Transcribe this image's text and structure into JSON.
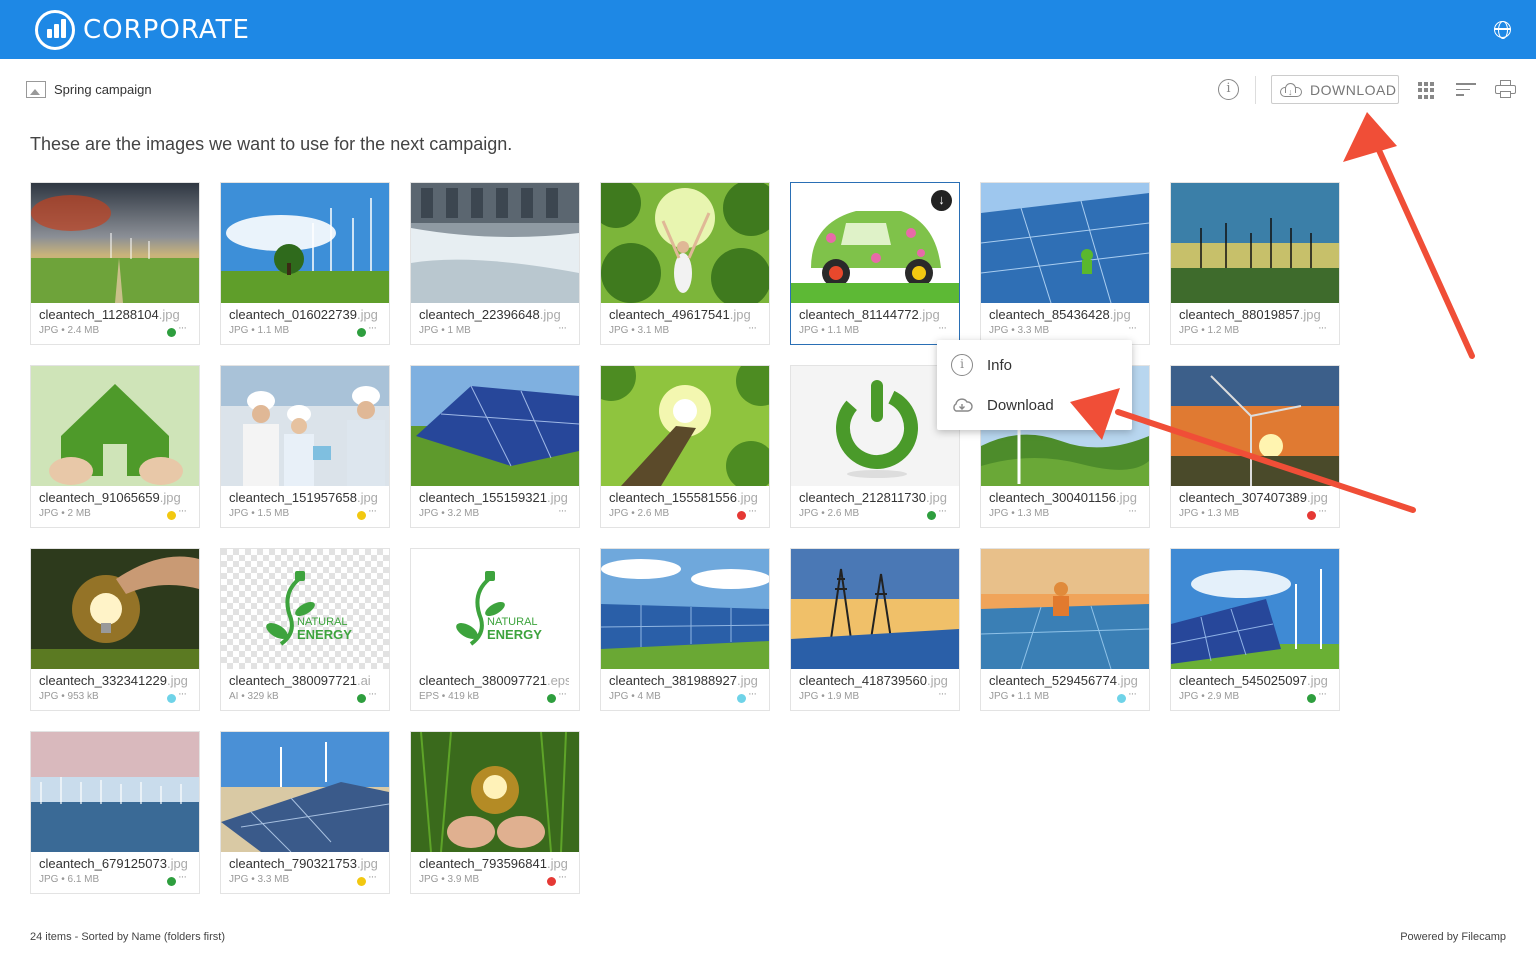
{
  "header": {
    "brand": "CORPORATE",
    "logo_icon": "bar-chart-logo-icon",
    "language_icon": "globe-icon",
    "color": "#1e88e5"
  },
  "toolbar": {
    "breadcrumb": "Spring campaign",
    "breadcrumb_icon": "image-folder-icon",
    "info_icon": "info-icon",
    "download_label": "DOWNLOAD",
    "view_icon": "grid-view-icon",
    "sort_icon": "sort-icon",
    "print_icon": "print-icon"
  },
  "description": "These are the images we want to use for the next campaign.",
  "items": [
    {
      "name": "cleantech_11288104",
      "ext": ".jpg",
      "meta": "JPG • 2.4 MB",
      "status": "#2e9e3e"
    },
    {
      "name": "cleantech_016022739",
      "ext": ".jpg",
      "meta": "JPG • 1.1 MB",
      "status": "#2e9e3e"
    },
    {
      "name": "cleantech_22396648",
      "ext": ".jpg",
      "meta": "JPG • 1 MB",
      "status": ""
    },
    {
      "name": "cleantech_49617541",
      "ext": ".jpg",
      "meta": "JPG • 3.1 MB",
      "status": ""
    },
    {
      "name": "cleantech_81144772",
      "ext": ".jpg",
      "meta": "JPG • 1.1 MB",
      "status": ""
    },
    {
      "name": "cleantech_85436428",
      "ext": ".jpg",
      "meta": "JPG • 3.3 MB",
      "status": ""
    },
    {
      "name": "cleantech_88019857",
      "ext": ".jpg",
      "meta": "JPG • 1.2 MB",
      "status": ""
    },
    {
      "name": "cleantech_91065659",
      "ext": ".jpg",
      "meta": "JPG • 2 MB",
      "status": "#f2c811"
    },
    {
      "name": "cleantech_151957658",
      "ext": ".jpg",
      "meta": "JPG • 1.5 MB",
      "status": "#f2c811"
    },
    {
      "name": "cleantech_155159321",
      "ext": ".jpg",
      "meta": "JPG • 3.2 MB",
      "status": ""
    },
    {
      "name": "cleantech_155581556",
      "ext": ".jpg",
      "meta": "JPG • 2.6 MB",
      "status": "#e53935"
    },
    {
      "name": "cleantech_212811730",
      "ext": ".jpg",
      "meta": "JPG • 2.6 MB",
      "status": "#2e9e3e"
    },
    {
      "name": "cleantech_300401156",
      "ext": ".jpg",
      "meta": "JPG • 1.3 MB",
      "status": ""
    },
    {
      "name": "cleantech_307407389",
      "ext": ".jpg",
      "meta": "JPG • 1.3 MB",
      "status": "#e53935"
    },
    {
      "name": "cleantech_332341229",
      "ext": ".jpg",
      "meta": "JPG • 953 kB",
      "status": "#6fd3e8"
    },
    {
      "name": "cleantech_380097721",
      "ext": ".ai",
      "meta": "AI • 329 kB",
      "status": "#2e9e3e"
    },
    {
      "name": "cleantech_380097721",
      "ext": ".eps",
      "meta": "EPS • 419 kB",
      "status": "#2e9e3e"
    },
    {
      "name": "cleantech_381988927",
      "ext": ".jpg",
      "meta": "JPG • 4 MB",
      "status": "#6fd3e8"
    },
    {
      "name": "cleantech_418739560",
      "ext": ".jpg",
      "meta": "JPG • 1.9 MB",
      "status": ""
    },
    {
      "name": "cleantech_529456774",
      "ext": ".jpg",
      "meta": "JPG • 1.1 MB",
      "status": "#6fd3e8"
    },
    {
      "name": "cleantech_545025097",
      "ext": ".jpg",
      "meta": "JPG • 2.9 MB",
      "status": "#2e9e3e"
    },
    {
      "name": "cleantech_679125073",
      "ext": ".jpg",
      "meta": "JPG • 6.1 MB",
      "status": "#2e9e3e"
    },
    {
      "name": "cleantech_790321753",
      "ext": ".jpg",
      "meta": "JPG • 3.3 MB",
      "status": "#f2c811"
    },
    {
      "name": "cleantech_793596841",
      "ext": ".jpg",
      "meta": "JPG • 3.9 MB",
      "status": "#e53935"
    }
  ],
  "more_label": "···",
  "context_menu": {
    "info_label": "Info",
    "download_label": "Download"
  },
  "footer": {
    "summary": "24 items - Sorted by Name (folders first)",
    "powered": "Powered by Filecamp"
  },
  "thumb_logo": {
    "line1": "NATURAL",
    "line2": "ENERGY"
  }
}
